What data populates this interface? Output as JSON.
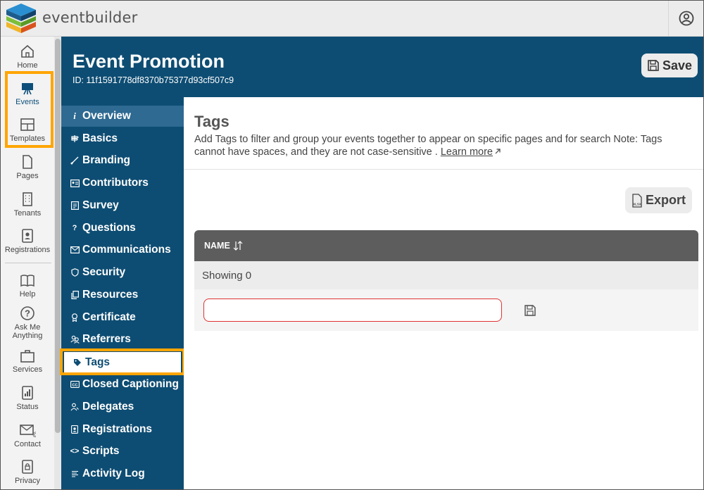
{
  "app": {
    "brand": "eventbuilder"
  },
  "rail": {
    "items": [
      {
        "label": "Home",
        "icon": "home-icon"
      },
      {
        "label": "Events",
        "icon": "easel-icon"
      },
      {
        "label": "Templates",
        "icon": "layout-icon"
      },
      {
        "label": "Pages",
        "icon": "page-icon"
      },
      {
        "label": "Tenants",
        "icon": "building-icon"
      },
      {
        "label": "Registrations",
        "icon": "badge-icon"
      },
      {
        "label": "Help",
        "icon": "book-icon"
      },
      {
        "label": "Ask Me",
        "label2": "Anything",
        "icon": "question-icon"
      },
      {
        "label": "Services",
        "icon": "briefcase-icon"
      },
      {
        "label": "Status",
        "icon": "bar-chart-icon"
      },
      {
        "label": "Contact",
        "icon": "mail-icon"
      },
      {
        "label": "Privacy",
        "icon": "lock-icon"
      }
    ]
  },
  "header": {
    "title": "Event Promotion",
    "event_id": "ID: 11f1591778df8370b75377d93cf507c9",
    "save_label": "Save"
  },
  "subnav": {
    "items": [
      {
        "label": "Overview",
        "icon": "info-icon"
      },
      {
        "label": "Basics",
        "icon": "signpost-icon"
      },
      {
        "label": "Branding",
        "icon": "brush-icon"
      },
      {
        "label": "Contributors",
        "icon": "id-card-icon"
      },
      {
        "label": "Survey",
        "icon": "form-icon"
      },
      {
        "label": "Questions",
        "icon": "question-icon"
      },
      {
        "label": "Communications",
        "icon": "envelope-icon"
      },
      {
        "label": "Security",
        "icon": "shield-icon"
      },
      {
        "label": "Resources",
        "icon": "copy-icon"
      },
      {
        "label": "Certificate",
        "icon": "award-icon"
      },
      {
        "label": "Referrers",
        "icon": "people-icon"
      },
      {
        "label": "Tags",
        "icon": "tag-icon"
      },
      {
        "label": "Closed Captioning",
        "icon": "cc-icon"
      },
      {
        "label": "Delegates",
        "icon": "delegate-icon"
      },
      {
        "label": "Registrations",
        "icon": "badge-icon"
      },
      {
        "label": "Scripts",
        "icon": "code-icon"
      },
      {
        "label": "Activity Log",
        "icon": "list-icon"
      }
    ],
    "selected": "Tags"
  },
  "main": {
    "title": "Tags",
    "description": "Add Tags to filter and group your events together to appear on specific pages and for search Note: Tags cannot have spaces, and they are not case-sensitive .",
    "learn_more": "Learn more",
    "export_label": "Export",
    "export_icon_text": "XLSX",
    "table": {
      "column_name": "NAME",
      "showing": "Showing 0",
      "input_value": "",
      "input_placeholder": ""
    }
  },
  "colors": {
    "primary": "#0e4d73",
    "highlight": "#ffa500",
    "input_error_border": "#e03131"
  }
}
